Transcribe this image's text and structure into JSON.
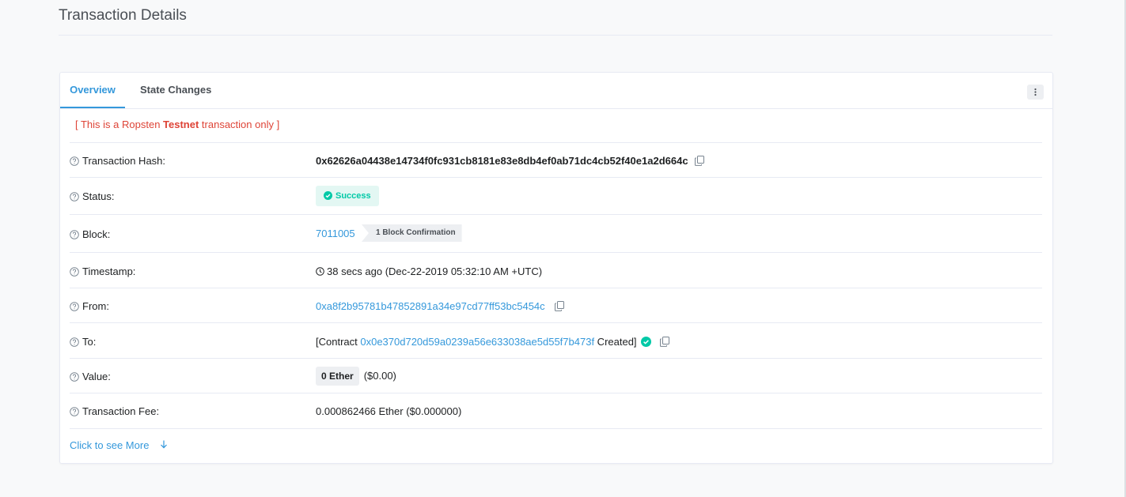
{
  "page": {
    "title": "Transaction Details"
  },
  "tabs": [
    {
      "label": "Overview",
      "active": true
    },
    {
      "label": "State Changes",
      "active": false
    }
  ],
  "notice": {
    "prefix": "[ This is a Ropsten ",
    "bold": "Testnet",
    "suffix": " transaction only ]"
  },
  "rows": {
    "hash": {
      "label": "Transaction Hash:",
      "value": "0x62626a04438e14734f0fc931cb8181e83e8db4ef0ab71dc4cb52f40e1a2d664c"
    },
    "status": {
      "label": "Status:",
      "value": "Success"
    },
    "block": {
      "label": "Block:",
      "value": "7011005",
      "confirmations": "1 Block Confirmation"
    },
    "timestamp": {
      "label": "Timestamp:",
      "value": "38 secs ago (Dec-22-2019 05:32:10 AM +UTC)"
    },
    "from": {
      "label": "From:",
      "value": "0xa8f2b95781b47852891a34e97cd77ff53bc5454c"
    },
    "to": {
      "label": "To:",
      "prefix": "[Contract ",
      "address": "0x0e370d720d59a0239a56e633038ae5d55f7b473f",
      "suffix": " Created]"
    },
    "value": {
      "label": "Value:",
      "amount": "0 Ether",
      "usd": "($0.00)"
    },
    "fee": {
      "label": "Transaction Fee:",
      "value": "0.000862466 Ether ($0.000000)"
    }
  },
  "see_more": "Click to see More",
  "colors": {
    "link": "#3498db",
    "success": "#00c9a7",
    "testnet_red": "#de4437"
  },
  "icons": [
    "question-circle-icon",
    "copy-icon",
    "check-circle-icon",
    "clock-icon",
    "arrow-down-icon",
    "vertical-ellipsis-icon"
  ]
}
